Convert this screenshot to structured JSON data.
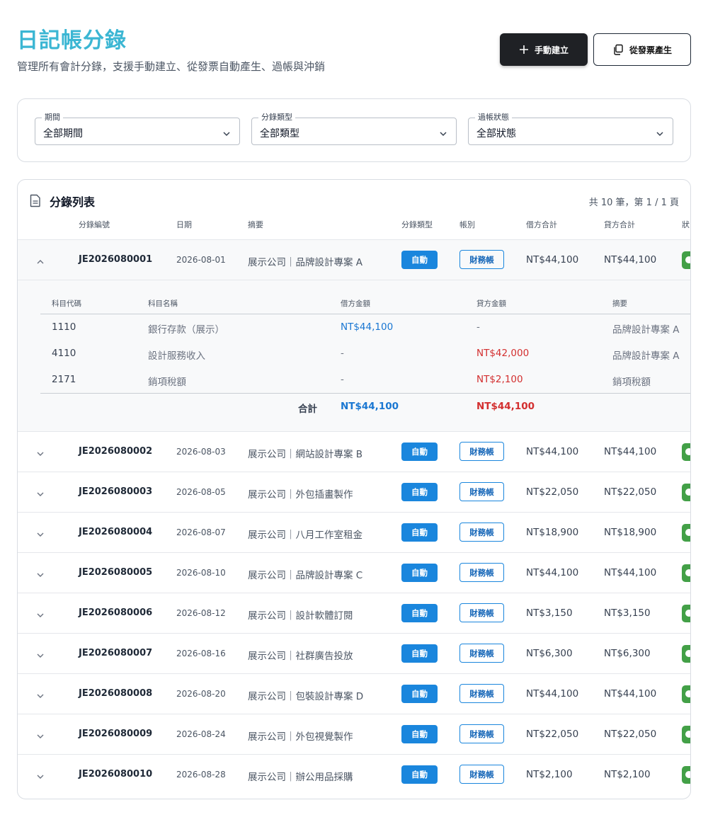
{
  "header": {
    "title": "日記帳分錄",
    "subtitle": "管理所有會計分錄，支援手動建立、從發票自動產生、過帳與沖銷",
    "create_button": "手動建立",
    "invoice_button": "從發票產生"
  },
  "filters": [
    {
      "label": "期間",
      "value": "全部期間"
    },
    {
      "label": "分錄類型",
      "value": "全部類型"
    },
    {
      "label": "過帳狀態",
      "value": "全部狀態"
    }
  ],
  "list": {
    "title": "分錄列表",
    "count": "共 10 筆，第 1 / 1 頁",
    "columns": [
      "分錄編號",
      "日期",
      "摘要",
      "分錄類型",
      "帳別",
      "借方合計",
      "貸方合計",
      "狀"
    ],
    "rows": [
      {
        "id": "JE2026080001",
        "date": "2026-08-01",
        "desc": "展示公司｜品牌設計專案 A",
        "type": "自動",
        "book": "財務帳",
        "debit": "NT$44,100",
        "credit": "NT$44,100"
      },
      {
        "id": "JE2026080002",
        "date": "2026-08-03",
        "desc": "展示公司｜網站設計專案 B",
        "type": "自動",
        "book": "財務帳",
        "debit": "NT$44,100",
        "credit": "NT$44,100"
      },
      {
        "id": "JE2026080003",
        "date": "2026-08-05",
        "desc": "展示公司｜外包插畫製作",
        "type": "自動",
        "book": "財務帳",
        "debit": "NT$22,050",
        "credit": "NT$22,050"
      },
      {
        "id": "JE2026080004",
        "date": "2026-08-07",
        "desc": "展示公司｜八月工作室租金",
        "type": "自動",
        "book": "財務帳",
        "debit": "NT$18,900",
        "credit": "NT$18,900"
      },
      {
        "id": "JE2026080005",
        "date": "2026-08-10",
        "desc": "展示公司｜品牌設計專案 C",
        "type": "自動",
        "book": "財務帳",
        "debit": "NT$44,100",
        "credit": "NT$44,100"
      },
      {
        "id": "JE2026080006",
        "date": "2026-08-12",
        "desc": "展示公司｜設計軟體訂閱",
        "type": "自動",
        "book": "財務帳",
        "debit": "NT$3,150",
        "credit": "NT$3,150"
      },
      {
        "id": "JE2026080007",
        "date": "2026-08-16",
        "desc": "展示公司｜社群廣告投放",
        "type": "自動",
        "book": "財務帳",
        "debit": "NT$6,300",
        "credit": "NT$6,300"
      },
      {
        "id": "JE2026080008",
        "date": "2026-08-20",
        "desc": "展示公司｜包裝設計專案 D",
        "type": "自動",
        "book": "財務帳",
        "debit": "NT$44,100",
        "credit": "NT$44,100"
      },
      {
        "id": "JE2026080009",
        "date": "2026-08-24",
        "desc": "展示公司｜外包視覺製作",
        "type": "自動",
        "book": "財務帳",
        "debit": "NT$22,050",
        "credit": "NT$22,050"
      },
      {
        "id": "JE2026080010",
        "date": "2026-08-28",
        "desc": "展示公司｜辦公用品採購",
        "type": "自動",
        "book": "財務帳",
        "debit": "NT$2,100",
        "credit": "NT$2,100"
      }
    ]
  },
  "detail": {
    "columns": [
      "科目代碼",
      "科目名稱",
      "借方金額",
      "貸方金額",
      "摘要"
    ],
    "lines": [
      {
        "code": "1110",
        "name": "銀行存款（展示）",
        "debit": "NT$44,100",
        "credit": "-",
        "memo": "品牌設計專案 A"
      },
      {
        "code": "4110",
        "name": "設計服務收入",
        "debit": "-",
        "credit": "NT$42,000",
        "memo": "品牌設計專案 A"
      },
      {
        "code": "2171",
        "name": "銷項稅額",
        "debit": "-",
        "credit": "NT$2,100",
        "memo": "銷項稅額"
      }
    ],
    "total_label": "合計",
    "total_debit": "NT$44,100",
    "total_credit": "NT$44,100"
  },
  "colors": {
    "accent": "#3bb6d3",
    "primary": "#1a86dd",
    "debit": "#1a77d2",
    "credit": "#d32f2f",
    "status": "#43a047"
  },
  "icons": {
    "create": "plus-icon",
    "invoice": "copy-icon",
    "list": "document-icon",
    "expand": "chevron-down-icon",
    "collapse": "chevron-up-icon"
  }
}
